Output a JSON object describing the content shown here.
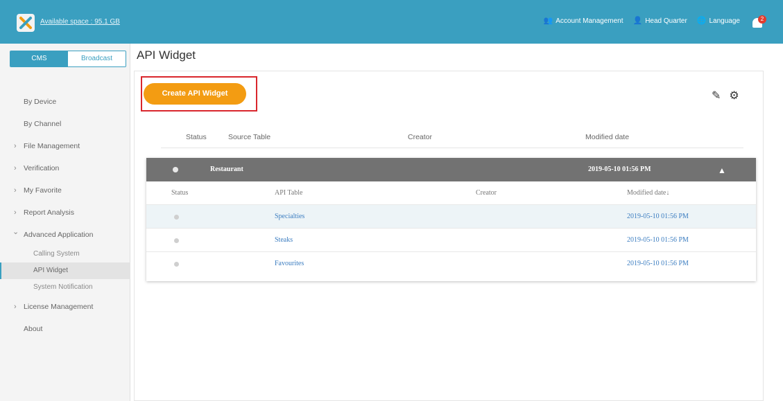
{
  "header": {
    "available_space": "Available space : 95.1 GB",
    "nav": [
      {
        "label": "Account Management",
        "icon": "users-icon"
      },
      {
        "label": "Head Quarter",
        "icon": "user-icon"
      },
      {
        "label": "Language",
        "icon": "globe-icon"
      }
    ],
    "notification_count": "2"
  },
  "sidebar": {
    "tabs": [
      "CMS",
      "Broadcast"
    ],
    "items": {
      "by_device": "By Device",
      "by_channel": "By Channel",
      "file_management": "File Management",
      "verification": "Verification",
      "my_favorite": "My Favorite",
      "report_analysis": "Report Analysis",
      "advanced_application": "Advanced Application",
      "calling_system": "Calling System",
      "api_widget": "API Widget",
      "system_notification": "System Notification",
      "license_management": "License Management",
      "about": "About"
    }
  },
  "main": {
    "title": "API Widget",
    "create_button": "Create API Widget",
    "columns": [
      "Status",
      "Source Table",
      "Creator",
      "Modified date"
    ],
    "group": {
      "name": "Restaurant",
      "modified": "2019-05-10 01:56 PM",
      "sub_columns": [
        "Status",
        "API Table",
        "Creator",
        "Modified date↓"
      ],
      "rows": [
        {
          "table": "Specialties",
          "creator": "",
          "modified": "2019-05-10 01:56 PM"
        },
        {
          "table": "Steaks",
          "creator": "",
          "modified": "2019-05-10 01:56 PM"
        },
        {
          "table": "Favourites",
          "creator": "",
          "modified": "2019-05-10 01:56 PM"
        }
      ]
    }
  },
  "colors": {
    "topbar": "#3a9fc0",
    "accent_button": "#f39c12",
    "highlight_border": "#d9262c",
    "group_header": "#727272"
  }
}
